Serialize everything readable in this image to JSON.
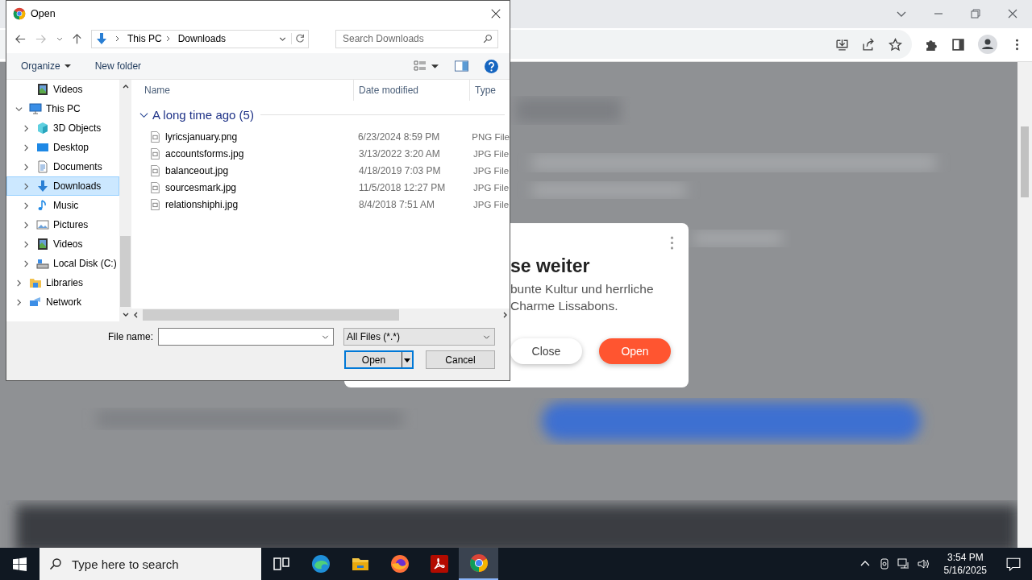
{
  "dialog": {
    "title": "Open",
    "breadcrumb": [
      "This PC",
      "Downloads"
    ],
    "search": {
      "placeholder": "Search Downloads"
    },
    "toolbar": {
      "organize": "Organize",
      "new_folder": "New folder"
    },
    "nav": [
      {
        "children": [
          {
            "label": "Videos",
            "kind": "video",
            "selected": false
          }
        ]
      },
      {
        "label": "This PC",
        "kind": "pc",
        "expanded": true,
        "selected": false,
        "children": [
          {
            "label": "3D Objects",
            "kind": "cube",
            "expanded": false,
            "selected": false
          },
          {
            "label": "Desktop",
            "kind": "desktop",
            "expanded": false,
            "selected": false
          },
          {
            "label": "Documents",
            "kind": "document",
            "expanded": false,
            "selected": false
          },
          {
            "label": "Downloads",
            "kind": "download",
            "expanded": false,
            "selected": true
          },
          {
            "label": "Music",
            "kind": "music",
            "expanded": false,
            "selected": false
          },
          {
            "label": "Pictures",
            "kind": "picture",
            "expanded": false,
            "selected": false
          },
          {
            "label": "Videos",
            "kind": "video",
            "expanded": false,
            "selected": false
          },
          {
            "label": "Local Disk (C:)",
            "kind": "disk",
            "expanded": false,
            "selected": false
          }
        ]
      },
      {
        "label": "Libraries",
        "kind": "library",
        "expanded": false,
        "selected": false
      },
      {
        "label": "Network",
        "kind": "network",
        "expanded": false,
        "selected": false
      }
    ],
    "columns": [
      "Name",
      "Date modified",
      "Type"
    ],
    "groups": [
      {
        "label": "A long time ago (5)",
        "expanded": true,
        "files": [
          {
            "name": "lyricsjanuary.png",
            "date": "6/23/2024 8:59 PM",
            "type": "PNG File"
          },
          {
            "name": "accountsforms.jpg",
            "date": "3/13/2022 3:20 AM",
            "type": "JPG File"
          },
          {
            "name": "balanceout.jpg",
            "date": "4/18/2019 7:03 PM",
            "type": "JPG File"
          },
          {
            "name": "sourcesmark.jpg",
            "date": "11/5/2018 12:27 PM",
            "type": "JPG File"
          },
          {
            "name": "relationshiphi.jpg",
            "date": "8/4/2018 7:51 AM",
            "type": "JPG File"
          }
        ]
      }
    ],
    "file_name_label": "File name:",
    "filter": "All Files (*.*)",
    "open_button": "Open",
    "cancel_button": "Cancel"
  },
  "popup": {
    "title": "se weiter",
    "lines": [
      "bunte Kultur und herrliche",
      "Charme Lissabons."
    ],
    "buttons": [
      {
        "label": "Close",
        "kind": "secondary"
      },
      {
        "label": "Open",
        "kind": "primary"
      }
    ]
  },
  "taskbar": {
    "search": {
      "placeholder": "Type here to search"
    },
    "apps": [
      {
        "kind": "taskview",
        "selected": false
      },
      {
        "kind": "edge",
        "selected": false
      },
      {
        "kind": "folder",
        "selected": false
      },
      {
        "kind": "firefox",
        "selected": false
      },
      {
        "kind": "acrobat",
        "selected": false
      },
      {
        "kind": "chrome",
        "selected": true
      }
    ],
    "time": "3:54 PM",
    "date": "5/16/2025"
  }
}
